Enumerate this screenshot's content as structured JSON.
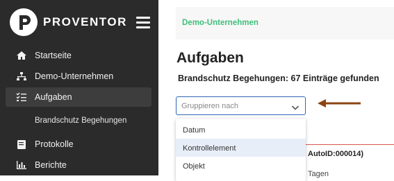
{
  "brand": {
    "name": "PROVENTOR"
  },
  "nav": {
    "items": [
      {
        "label": "Startseite",
        "icon": "home-icon"
      },
      {
        "label": "Demo-Unternehmen",
        "icon": "org-icon"
      },
      {
        "label": "Aufgaben",
        "icon": "checklist-icon",
        "active": true
      },
      {
        "label": "Protokolle",
        "icon": "book-icon"
      },
      {
        "label": "Berichte",
        "icon": "bar-chart-icon"
      }
    ],
    "sub_item": "Brandschutz Begehungen"
  },
  "breadcrumb": "Demo-Unternehmen",
  "page": {
    "title": "Aufgaben",
    "result_line": "Brandschutz Begehungen: 67 Einträge gefunden"
  },
  "groupby": {
    "placeholder": "Gruppieren nach",
    "options": [
      "Datum",
      "Kontrollelement",
      "Objekt"
    ],
    "highlighted": "Kontrollelement"
  },
  "background": {
    "fragment1": "AutoID:000014)",
    "fragment2": "Tagen"
  },
  "colors": {
    "sidebar": "#2b2b2b",
    "accent_green": "#3fbf7a",
    "focus_blue": "#2f67b5",
    "arrow": "#8b4513"
  }
}
